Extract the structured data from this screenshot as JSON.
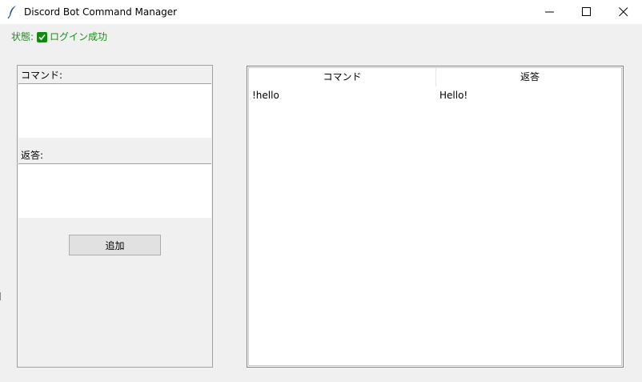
{
  "window": {
    "title": "Discord Bot Command Manager",
    "icon": "feather-icon"
  },
  "status": {
    "label": "状態:",
    "icon": "checkbox-checked-icon",
    "text": "ログイン成功",
    "color": "#1a8f1a"
  },
  "form": {
    "command_label": "コマンド:",
    "command_value": "",
    "response_label": "返答:",
    "response_value": "",
    "add_button_label": "追加"
  },
  "table": {
    "columns": [
      "コマンド",
      "返答"
    ],
    "rows": [
      {
        "command": "!hello",
        "response": "Hello!"
      }
    ]
  }
}
